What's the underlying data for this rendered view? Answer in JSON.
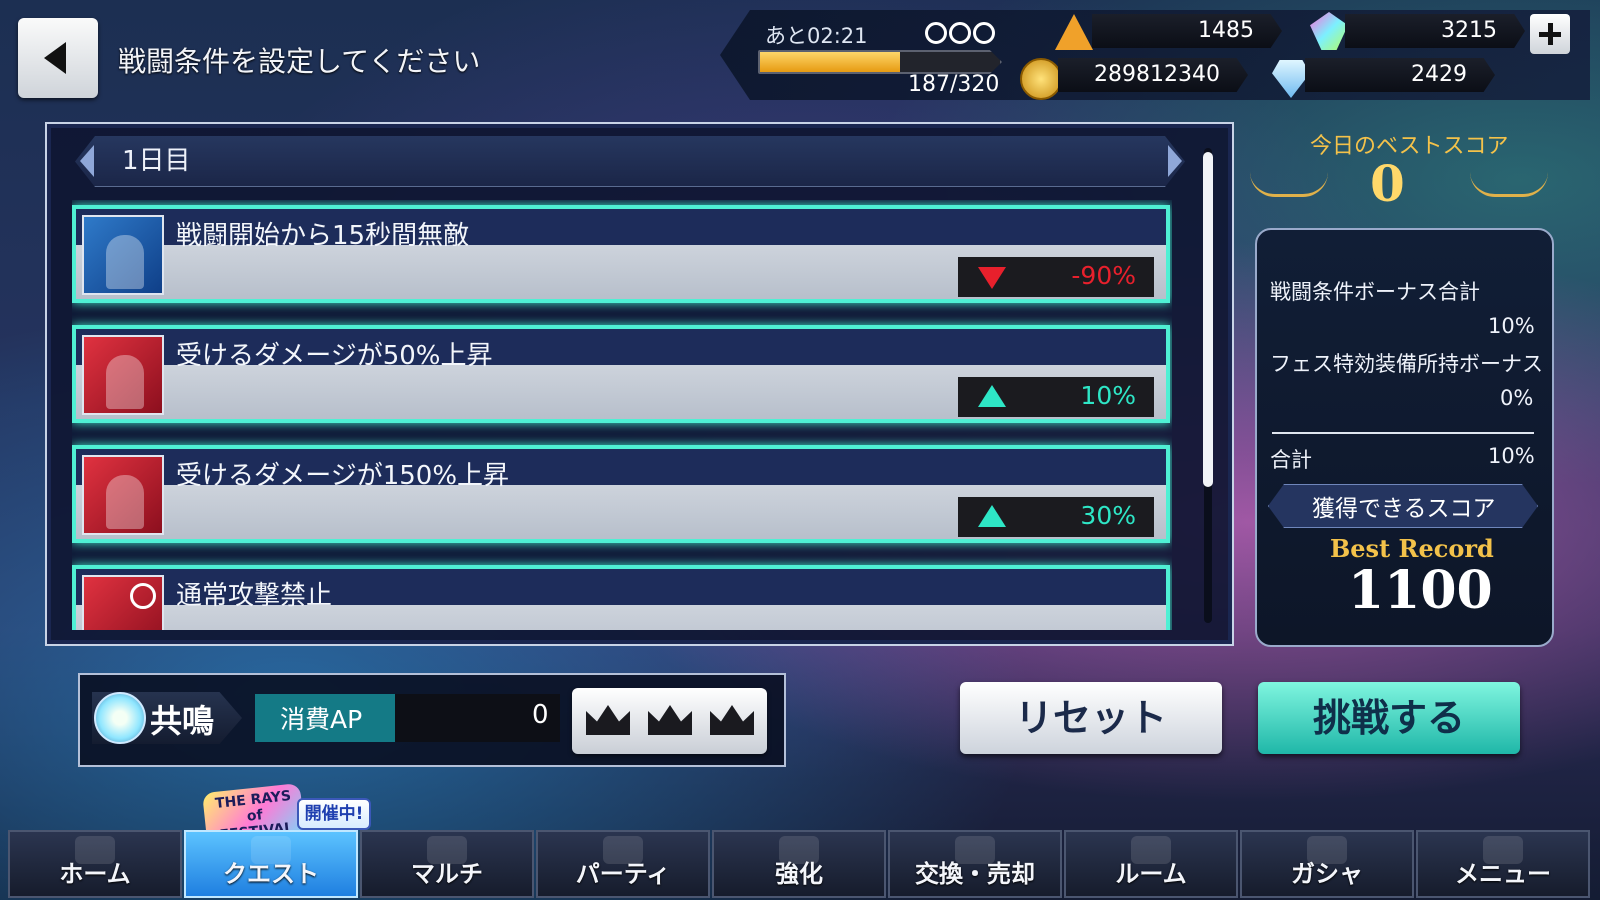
{
  "header": {
    "title": "戦闘条件を設定してください"
  },
  "status": {
    "time_remaining": "あと02:21",
    "stamina_text": "187/320",
    "stamina_fraction": 0.584,
    "pyramid_currency": "1485",
    "crystal_currency": "3215",
    "gold_currency": "289812340",
    "diamond_currency": "2429"
  },
  "day": {
    "label": "1日目"
  },
  "conditions": [
    {
      "title": "戦闘開始から15秒間無敵",
      "value": "-90%",
      "direction": "down",
      "icon": "invincible-icon",
      "color": "#e8202c"
    },
    {
      "title": "受けるダメージが50%上昇",
      "value": "10%",
      "direction": "up",
      "icon": "damage-up-icon",
      "color": "#2ee6c6"
    },
    {
      "title": "受けるダメージが150%上昇",
      "value": "30%",
      "direction": "up",
      "icon": "damage-up-icon",
      "color": "#2ee6c6"
    },
    {
      "title": "通常攻撃禁止",
      "value": "",
      "direction": "",
      "icon": "attack-ban-icon",
      "color": "#2ee6c6"
    }
  ],
  "best_score": {
    "title": "今日のベストスコア",
    "value": "0"
  },
  "bonus": {
    "condition_bonus_label": "戦闘条件ボーナス合計",
    "condition_bonus_value": "10%",
    "fes_bonus_label": "フェス特効装備所持ボーナス",
    "fes_bonus_value": "0%",
    "total_label": "合計",
    "total_value": "10%",
    "score_label": "獲得できるスコア",
    "best_record_label": "Best Record",
    "best_record_value": "1100"
  },
  "ap": {
    "resonance_label": "共鳴",
    "label": "消費AP",
    "value": "0"
  },
  "buttons": {
    "reset": "リセット",
    "challenge": "挑戦する"
  },
  "event": {
    "logo_text": "THE RAYS of FESTIVAL",
    "tag": "開催中!"
  },
  "nav": {
    "items": [
      "ホーム",
      "クエスト",
      "マルチ",
      "パーティ",
      "強化",
      "交換・売却",
      "ルーム",
      "ガシャ",
      "メニュー"
    ],
    "active_index": 1
  }
}
